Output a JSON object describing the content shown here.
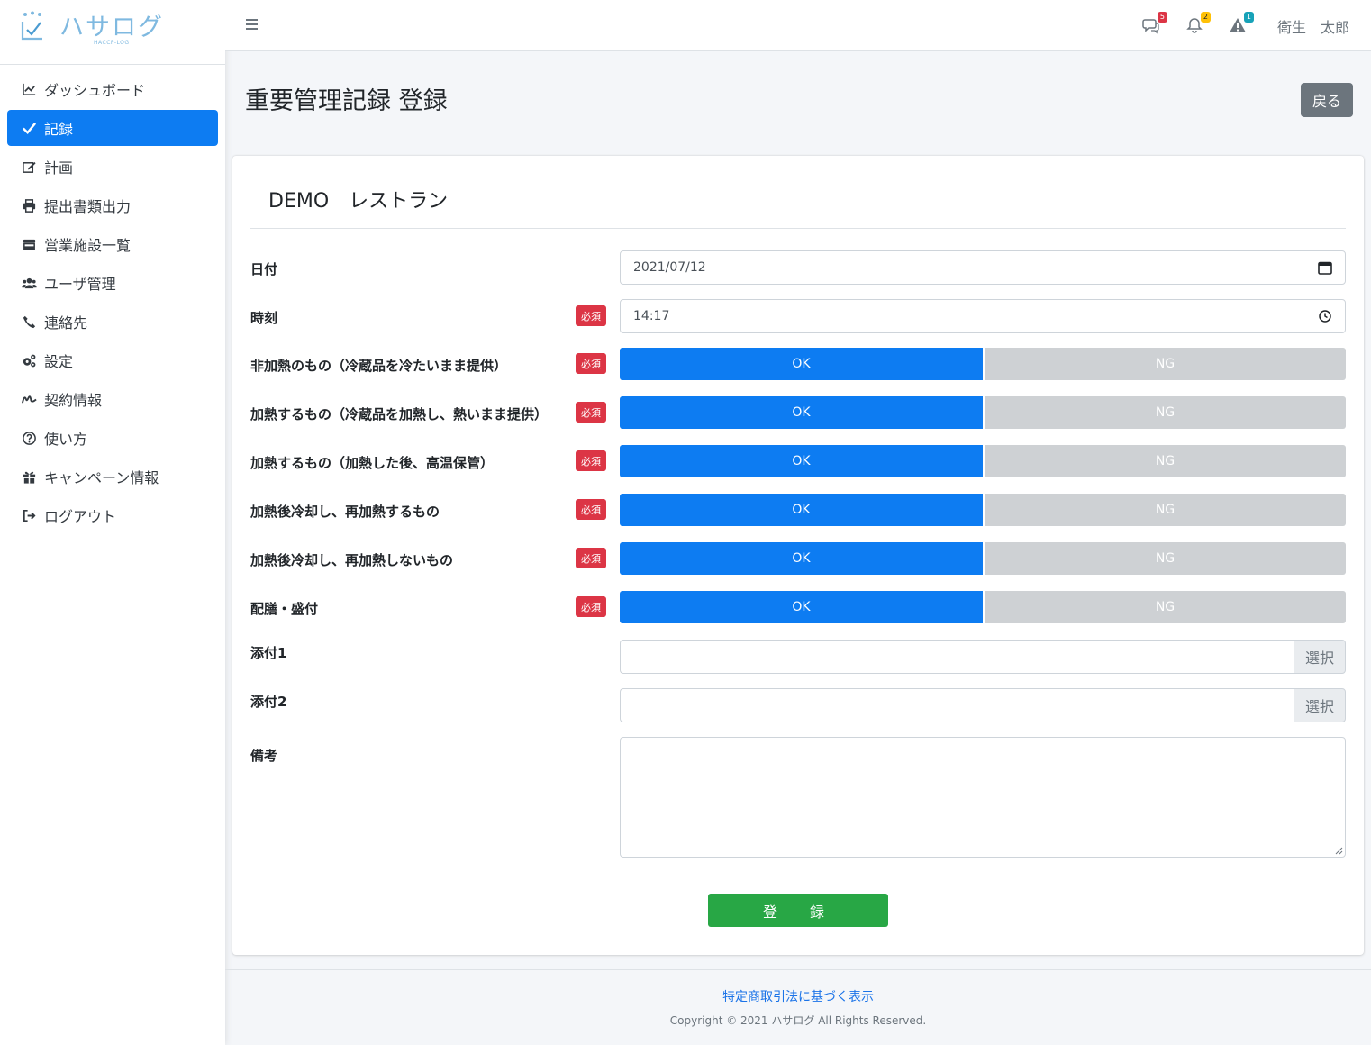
{
  "brand": {
    "name": "ハサログ",
    "subtitle": "HACCP-LOG"
  },
  "sidebar": {
    "items": [
      {
        "label": "ダッシュボード",
        "icon": "chart-line-icon",
        "active": false
      },
      {
        "label": "記録",
        "icon": "check-icon",
        "active": true
      },
      {
        "label": "計画",
        "icon": "edit-icon",
        "active": false
      },
      {
        "label": "提出書類出力",
        "icon": "print-icon",
        "active": false
      },
      {
        "label": "営業施設一覧",
        "icon": "store-icon",
        "active": false
      },
      {
        "label": "ユーザ管理",
        "icon": "users-icon",
        "active": false
      },
      {
        "label": "連絡先",
        "icon": "phone-icon",
        "active": false
      },
      {
        "label": "設定",
        "icon": "cogs-icon",
        "active": false
      },
      {
        "label": "契約情報",
        "icon": "signature-icon",
        "active": false
      },
      {
        "label": "使い方",
        "icon": "question-circle-icon",
        "active": false
      },
      {
        "label": "キャンペーン情報",
        "icon": "gift-icon",
        "active": false
      },
      {
        "label": "ログアウト",
        "icon": "sign-out-icon",
        "active": false
      }
    ]
  },
  "topbar": {
    "badges": {
      "messages": "5",
      "notifications": "2",
      "alerts": "1"
    },
    "badge_colors": {
      "messages": "#dc3545",
      "notifications": "#ffc107",
      "alerts": "#17a2b8"
    },
    "user": "衛生　太郎"
  },
  "page": {
    "title": "重要管理記録 登録",
    "back_label": "戻る"
  },
  "form": {
    "facility": "DEMO　レストラン",
    "required_label": "必須",
    "date": {
      "label": "日付",
      "value": "2021/07/12"
    },
    "time": {
      "label": "時刻",
      "value": "14:17"
    },
    "checks": [
      {
        "label": "非加熱のもの（冷蔵品を冷たいまま提供）",
        "ok": "OK",
        "ng": "NG",
        "selected": "OK"
      },
      {
        "label": "加熱するもの（冷蔵品を加熱し、熱いまま提供）",
        "ok": "OK",
        "ng": "NG",
        "selected": "OK"
      },
      {
        "label": "加熱するもの（加熱した後、高温保管）",
        "ok": "OK",
        "ng": "NG",
        "selected": "OK"
      },
      {
        "label": "加熱後冷却し、再加熱するもの",
        "ok": "OK",
        "ng": "NG",
        "selected": "OK"
      },
      {
        "label": "加熱後冷却し、再加熱しないもの",
        "ok": "OK",
        "ng": "NG",
        "selected": "OK"
      },
      {
        "label": "配膳・盛付",
        "ok": "OK",
        "ng": "NG",
        "selected": "OK"
      }
    ],
    "attachments": [
      {
        "label": "添付1",
        "button": "選択"
      },
      {
        "label": "添付2",
        "button": "選択"
      }
    ],
    "remarks": {
      "label": "備考",
      "value": ""
    },
    "submit_label": "登　録"
  },
  "footer": {
    "link": "特定商取引法に基づく表示",
    "copyright": "Copyright © 2021 ハサログ All Rights Reserved."
  },
  "colors": {
    "primary": "#0d7cf2",
    "danger": "#dc3545",
    "success": "#28a745",
    "secondary": "#6c757d"
  }
}
